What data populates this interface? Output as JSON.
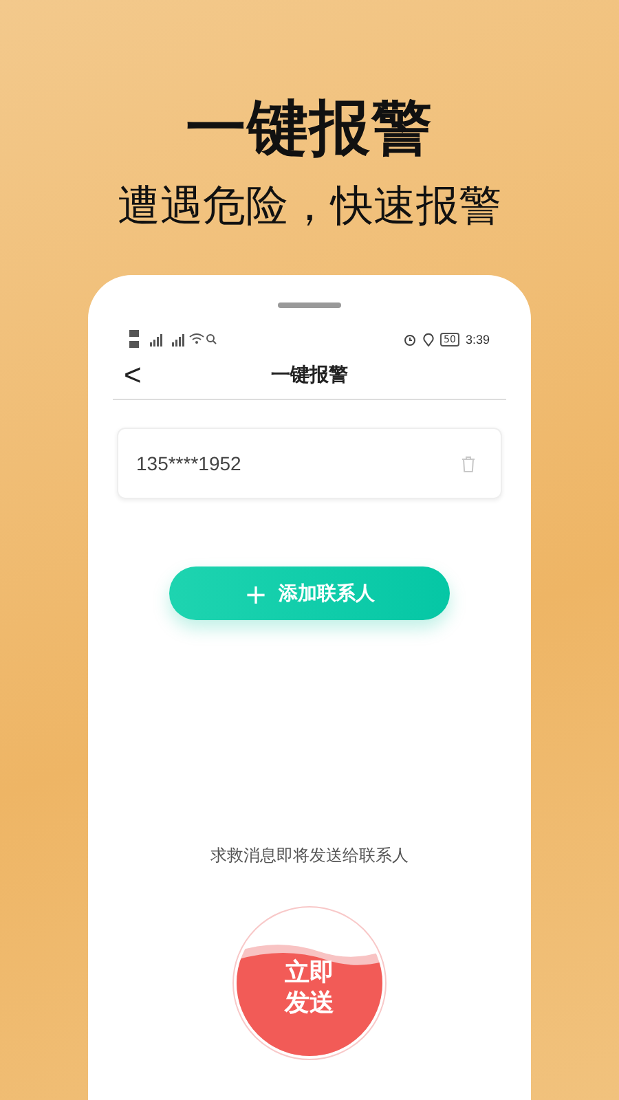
{
  "headline": "一键报警",
  "subtitle": "遭遇危险，快速报警",
  "phone": {
    "status_bar": {
      "battery": "50",
      "time": "3:39"
    },
    "nav": {
      "back": "<",
      "title": "一键报警"
    },
    "contacts": [
      {
        "phone": "135****1952"
      }
    ],
    "add_button": {
      "icon": "+",
      "label": "添加联系人"
    },
    "hint": "求救消息即将发送给联系人",
    "send_button": {
      "lines": [
        "立即",
        "发送"
      ]
    }
  }
}
